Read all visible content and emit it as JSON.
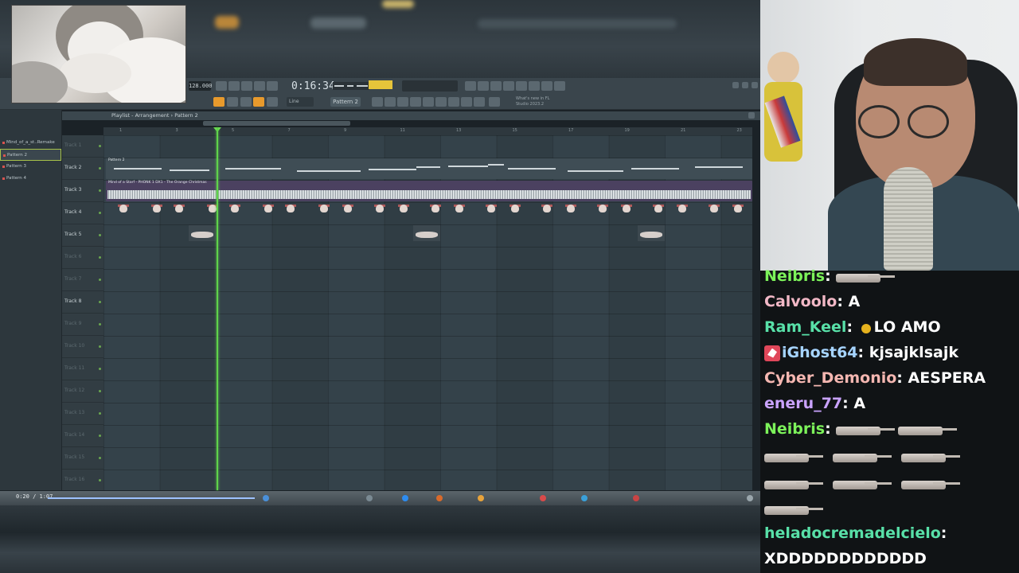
{
  "daw": {
    "tempo": "128.000",
    "song_time": "0:16:34",
    "cpu_hint": "17",
    "pattern_selector": "Pattern 2",
    "snap": "Line",
    "news_ticker": "What's new in FL Studio 2023.2",
    "playlist_title": "Playlist - Arrangement › Pattern 2",
    "browser_items": [
      {
        "label": "Mind_of_a_st..Remake",
        "selected": false
      },
      {
        "label": "Pattern 2",
        "selected": true
      },
      {
        "label": "Pattern 3",
        "selected": false
      },
      {
        "label": "Pattern 4",
        "selected": false
      }
    ],
    "ruler_bars": [
      "1",
      "3",
      "5",
      "7",
      "9",
      "11",
      "13",
      "15",
      "17",
      "19",
      "21",
      "23"
    ],
    "tracks": [
      {
        "label": "Track 1",
        "dim": true
      },
      {
        "label": "Track 2",
        "dim": false
      },
      {
        "label": "Track 3",
        "dim": false
      },
      {
        "label": "Track 4",
        "dim": false
      },
      {
        "label": "Track 5",
        "dim": false
      },
      {
        "label": "Track 6",
        "dim": true
      },
      {
        "label": "Track 7",
        "dim": true
      },
      {
        "label": "Track 8",
        "dim": false
      },
      {
        "label": "Track 9",
        "dim": true
      },
      {
        "label": "Track 10",
        "dim": true
      },
      {
        "label": "Track 11",
        "dim": true
      },
      {
        "label": "Track 12",
        "dim": true
      },
      {
        "label": "Track 13",
        "dim": true
      },
      {
        "label": "Track 14",
        "dim": true
      },
      {
        "label": "Track 15",
        "dim": true
      },
      {
        "label": "Track 16",
        "dim": true
      }
    ],
    "clips": {
      "pattern_clip_label": "Pattern 2",
      "audio_clip_label": "Mind of a Starf - PHONK 1 DX1 - The Orange Christmas"
    }
  },
  "taskbar": {
    "timestamp": "0:20 / 1:07"
  },
  "chat": {
    "messages": [
      {
        "user": "Neibris",
        "color": "#7cf25a",
        "text": "",
        "emotes": 1
      },
      {
        "user": "Calvoolo",
        "color": "#f2b8c6",
        "text": "A",
        "emotes": 0
      },
      {
        "user": "Ram_Keel",
        "color": "#58e0a8",
        "text": "LO AMO",
        "emotes": 0,
        "small_emote": true
      },
      {
        "user": "iGhost64",
        "color": "#a6d4ff",
        "text": "kjsajklsajk",
        "emotes": 0,
        "badge": true
      },
      {
        "user": "Cyber_Demonio",
        "color": "#f5b7b1",
        "text": "AESPERA",
        "emotes": 0
      },
      {
        "user": "eneru_77",
        "color": "#caa3ff",
        "text": "A",
        "emotes": 0
      },
      {
        "user": "Neibris",
        "color": "#7cf25a",
        "text": "",
        "emotes": 9
      },
      {
        "user": "heladocremadelcielo",
        "color": "#58e0a8",
        "text": "XDDDDDDDDDDDD",
        "emotes": 0
      }
    ]
  }
}
